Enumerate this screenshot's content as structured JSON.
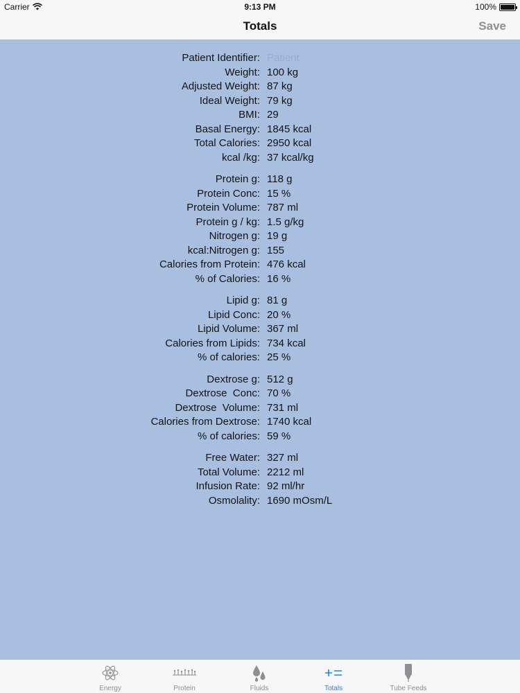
{
  "status_bar": {
    "carrier": "Carrier",
    "time": "9:13 PM",
    "battery": "100%"
  },
  "nav": {
    "title": "Totals",
    "save_label": "Save"
  },
  "sections": [
    {
      "rows": [
        {
          "label": "Patient Identifier:",
          "value": "Patient",
          "placeholder": true
        },
        {
          "label": "Weight:",
          "value": "100 kg"
        },
        {
          "label": "Adjusted Weight:",
          "value": "87 kg"
        },
        {
          "label": "Ideal Weight:",
          "value": "79 kg"
        },
        {
          "label": "BMI:",
          "value": "29"
        },
        {
          "label": "Basal Energy:",
          "value": "1845 kcal"
        },
        {
          "label": "Total Calories:",
          "value": "2950 kcal"
        },
        {
          "label": "kcal /kg:",
          "value": "37 kcal/kg"
        }
      ]
    },
    {
      "rows": [
        {
          "label": "Protein g:",
          "value": "118 g"
        },
        {
          "label": "Protein Conc:",
          "value": "15 %"
        },
        {
          "label": "Protein Volume:",
          "value": "787 ml"
        },
        {
          "label": "Protein g / kg:",
          "value": "1.5 g/kg"
        },
        {
          "label": "Nitrogen g:",
          "value": "19 g"
        },
        {
          "label": "kcal:Nitrogen g:",
          "value": "155"
        },
        {
          "label": "Calories from Protein:",
          "value": "476 kcal"
        },
        {
          "label": "% of Calories:",
          "value": "16 %"
        }
      ]
    },
    {
      "rows": [
        {
          "label": "Lipid g:",
          "value": "81 g"
        },
        {
          "label": "Lipid Conc:",
          "value": "20 %"
        },
        {
          "label": "Lipid Volume:",
          "value": "367 ml"
        },
        {
          "label": "Calories from Lipids:",
          "value": "734 kcal"
        },
        {
          "label": "% of calories:",
          "value": "25 %"
        }
      ]
    },
    {
      "rows": [
        {
          "label": "Dextrose g:",
          "value": "512 g"
        },
        {
          "label": "Dextrose  Conc:",
          "value": "70 %"
        },
        {
          "label": "Dextrose  Volume:",
          "value": "731 ml"
        },
        {
          "label": "Calories from Dextrose:",
          "value": "1740 kcal"
        },
        {
          "label": "% of calories:",
          "value": "59 %"
        }
      ]
    },
    {
      "rows": [
        {
          "label": "Free Water:",
          "value": "327 ml"
        },
        {
          "label": "Total Volume:",
          "value": "2212 ml"
        },
        {
          "label": "Infusion Rate:",
          "value": "92 ml/hr"
        },
        {
          "label": "Osmolality:",
          "value": "1690 mOsm/L"
        }
      ]
    }
  ],
  "tabs": [
    {
      "label": "Energy",
      "icon": "atom-icon",
      "active": false
    },
    {
      "label": "Protein",
      "icon": "protein-chain-icon",
      "active": false
    },
    {
      "label": "Fluids",
      "icon": "droplets-icon",
      "active": false
    },
    {
      "label": "Totals",
      "icon": "plus-equals-icon",
      "active": true
    },
    {
      "label": "Tube Feeds",
      "icon": "syringe-icon",
      "active": false
    }
  ],
  "colors": {
    "background": "#a9bfdf",
    "bar": "#f7f7f8",
    "accent": "#1a82fb",
    "inactive": "#8e8e93",
    "placeholder": "#9aaccc"
  }
}
